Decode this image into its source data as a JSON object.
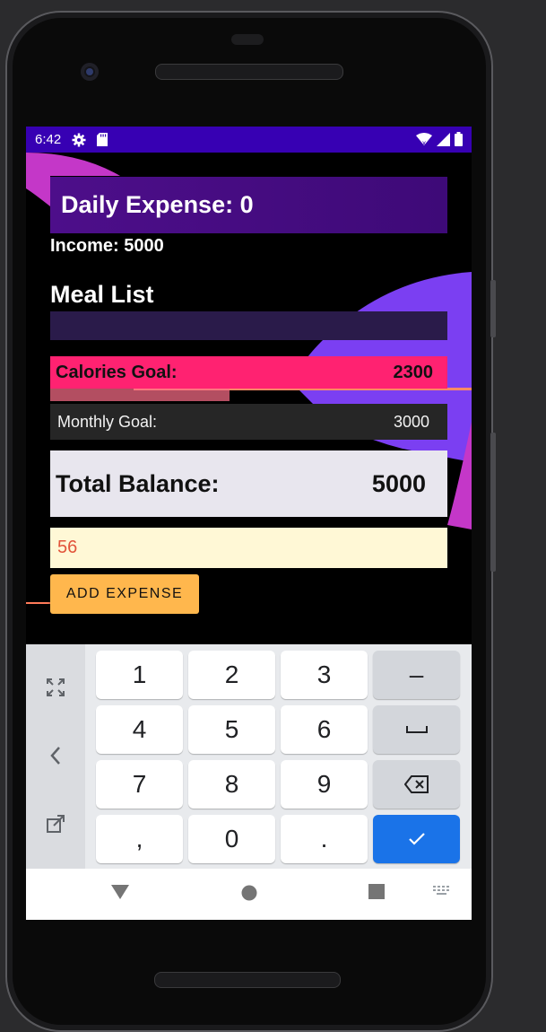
{
  "statusbar": {
    "time": "6:42",
    "icons": [
      "settings-icon",
      "sd-card-icon",
      "wifi-icon",
      "signal-icon",
      "battery-icon"
    ]
  },
  "app": {
    "daily_expense": "Daily Expense: 0",
    "income": "Income: 5000",
    "meal_list_title": "Meal List",
    "calories_goal_label": "Calories Goal:",
    "calories_goal_value": "2300",
    "monthly_goal_label": "Monthly Goal:",
    "monthly_goal_value": "3000",
    "total_balance_label": "Total Balance:",
    "total_balance_value": "5000",
    "expense_input_value": "56",
    "add_expense_button": "ADD EXPENSE"
  },
  "keyboard": {
    "side_icons": [
      "fullscreen-icon",
      "chevron-left-icon",
      "resize-icon"
    ],
    "rows": [
      [
        "1",
        "2",
        "3",
        "–"
      ],
      [
        "4",
        "5",
        "6",
        "space"
      ],
      [
        "7",
        "8",
        "9",
        "backspace"
      ],
      [
        ",",
        "0",
        ".",
        "done"
      ]
    ]
  },
  "navbar": {
    "icons": [
      "back-icon",
      "home-icon",
      "recents-icon",
      "keyboard-switch-icon"
    ]
  },
  "colors": {
    "statusbar": "#3700b3",
    "daily_bar": "#4d0e8a",
    "calories_bar": "#ff2271",
    "balance_bar": "#e8e6ee",
    "input_bg": "#fff8d6",
    "button": "#ffb74d",
    "done_key": "#1a73e8"
  }
}
